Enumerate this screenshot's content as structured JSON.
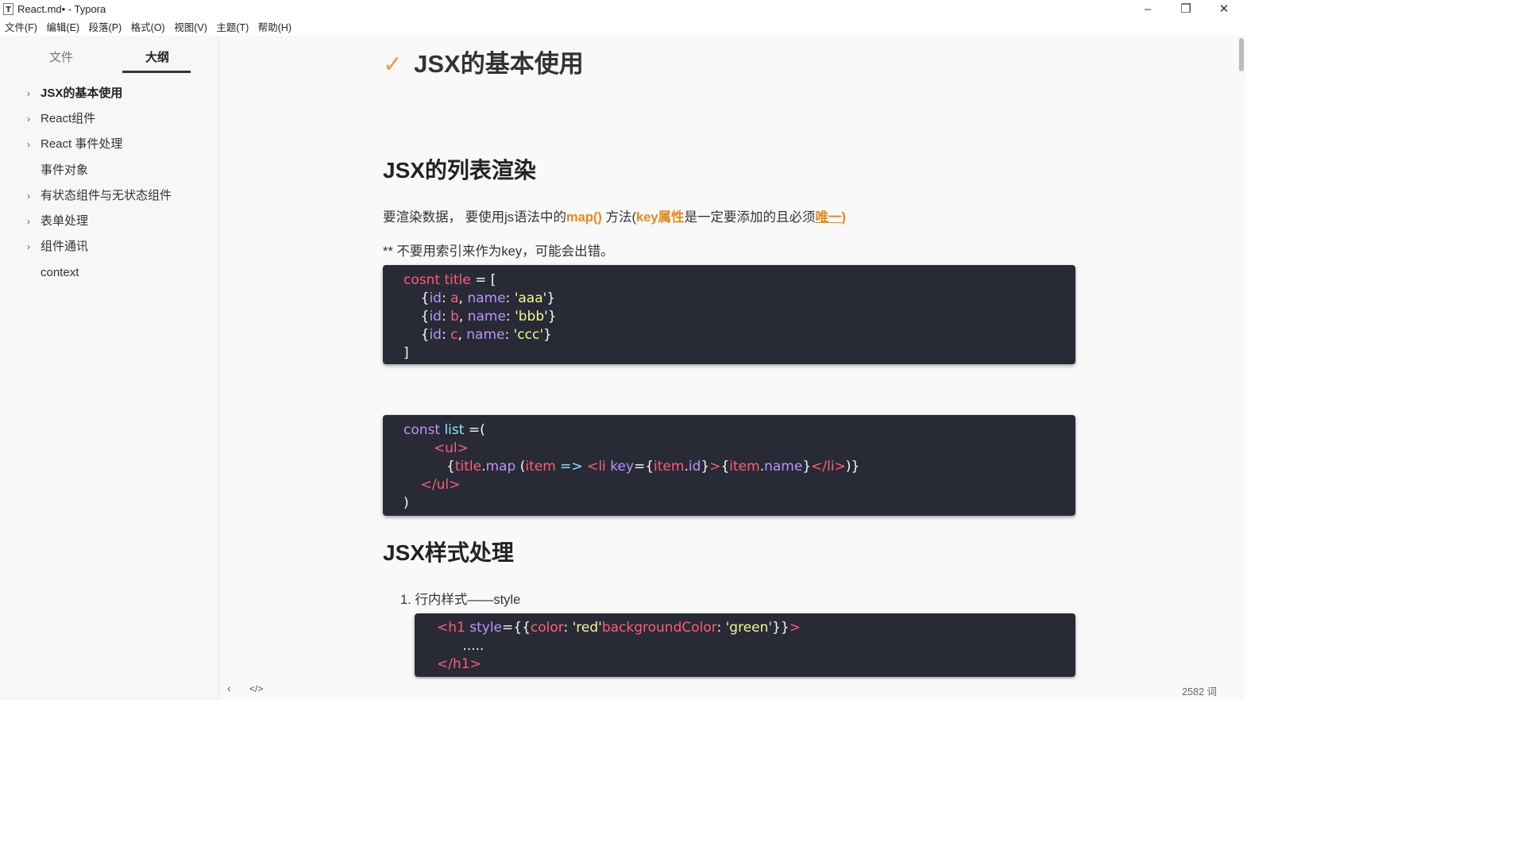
{
  "window": {
    "title": "React.md• - Typora",
    "app_icon": "T",
    "controls": {
      "minimize": "–",
      "restore": "❐",
      "close": "✕"
    }
  },
  "menu": [
    "文件(F)",
    "编辑(E)",
    "段落(P)",
    "格式(O)",
    "视图(V)",
    "主题(T)",
    "帮助(H)"
  ],
  "sidebar": {
    "tabs": {
      "files": "文件",
      "outline": "大纲"
    },
    "active_tab": "outline",
    "items": [
      {
        "label": "JSX的基本使用",
        "expandable": true,
        "bold": true
      },
      {
        "label": "React组件",
        "expandable": true,
        "bold": false
      },
      {
        "label": "React 事件处理",
        "expandable": true,
        "bold": false
      },
      {
        "label": "事件对象",
        "expandable": false,
        "bold": false
      },
      {
        "label": "有状态组件与无状态组件",
        "expandable": true,
        "bold": false
      },
      {
        "label": "表单处理",
        "expandable": true,
        "bold": false
      },
      {
        "label": "组件通讯",
        "expandable": true,
        "bold": false
      },
      {
        "label": "context",
        "expandable": false,
        "bold": false
      }
    ]
  },
  "document": {
    "h1": {
      "check": "✓",
      "text": "JSX的基本使用"
    },
    "h2_list": "JSX的列表渲染",
    "para1": {
      "prefix": "要渲染数据， 要使用js语法中的",
      "map": "map()",
      "mid": "  方法(",
      "key": "key属性",
      "mid2": "是一定要添加的且必须",
      "unique": "唯一",
      "close": ")"
    },
    "para2": "** 不要用索引来作为key，可能会出错。",
    "code1": [
      [
        [
          "r",
          "cosnt title"
        ],
        [
          "w",
          " = ["
        ]
      ],
      [
        [
          "w",
          "    {"
        ],
        [
          "p",
          "id"
        ],
        [
          "w",
          ": "
        ],
        [
          "r",
          "a"
        ],
        [
          "w",
          ", "
        ],
        [
          "p",
          "name"
        ],
        [
          "w",
          ": "
        ],
        [
          "s",
          "'aaa'"
        ],
        [
          "w",
          "}"
        ]
      ],
      [
        [
          "w",
          "    {"
        ],
        [
          "p",
          "id"
        ],
        [
          "w",
          ": "
        ],
        [
          "r",
          "b"
        ],
        [
          "w",
          ", "
        ],
        [
          "p",
          "name"
        ],
        [
          "w",
          ": "
        ],
        [
          "s",
          "'bbb'"
        ],
        [
          "w",
          "}"
        ]
      ],
      [
        [
          "w",
          "    {"
        ],
        [
          "p",
          "id"
        ],
        [
          "w",
          ": "
        ],
        [
          "r",
          "c"
        ],
        [
          "w",
          ", "
        ],
        [
          "p",
          "name"
        ],
        [
          "w",
          ": "
        ],
        [
          "s",
          "'ccc'"
        ],
        [
          "w",
          "}"
        ]
      ],
      [
        [
          "w",
          "]"
        ]
      ]
    ],
    "code2": [
      [
        [
          "p",
          "const"
        ],
        [
          "w",
          " "
        ],
        [
          "v",
          "list"
        ],
        [
          "w",
          " =("
        ]
      ],
      [
        [
          "w",
          "       "
        ],
        [
          "r",
          "<ul>"
        ]
      ],
      [
        [
          "w",
          "          {"
        ],
        [
          "r",
          "title"
        ],
        [
          "w",
          "."
        ],
        [
          "p",
          "map"
        ],
        [
          "w",
          " ("
        ],
        [
          "r",
          "item"
        ],
        [
          "w",
          " "
        ],
        [
          "v",
          "=>"
        ],
        [
          "w",
          " "
        ],
        [
          "r",
          "<li"
        ],
        [
          "w",
          " "
        ],
        [
          "p",
          "key"
        ],
        [
          "w",
          "={"
        ],
        [
          "r",
          "item"
        ],
        [
          "w",
          "."
        ],
        [
          "p",
          "id"
        ],
        [
          "w",
          "}"
        ],
        [
          "r",
          ">"
        ],
        [
          "w",
          "{"
        ],
        [
          "r",
          "item"
        ],
        [
          "w",
          "."
        ],
        [
          "p",
          "name"
        ],
        [
          "w",
          "}"
        ],
        [
          "r",
          "</li>"
        ],
        [
          "w",
          ")}"
        ]
      ],
      [
        [
          "w",
          "    "
        ],
        [
          "r",
          "</ul>"
        ]
      ],
      [
        [
          "w",
          ")"
        ]
      ]
    ],
    "h2_style": "JSX样式处理",
    "list_item_1": "1. 行内样式——style",
    "code3": [
      [
        [
          "r",
          "<h1"
        ],
        [
          "w",
          " "
        ],
        [
          "p",
          "style"
        ],
        [
          "w",
          "={{"
        ],
        [
          "r",
          "color"
        ],
        [
          "w",
          ": "
        ],
        [
          "s",
          "'red'"
        ],
        [
          "r",
          "backgroundColor"
        ],
        [
          "w",
          ": "
        ],
        [
          "s",
          "'green'"
        ],
        [
          "w",
          "}}"
        ],
        [
          "r",
          ">"
        ]
      ],
      [
        [
          "w",
          "      ....."
        ]
      ],
      [
        [
          "r",
          "</h1>"
        ]
      ]
    ]
  },
  "status": {
    "back_icon": "‹",
    "source_icon": "</>",
    "word_count": "2582 词"
  }
}
